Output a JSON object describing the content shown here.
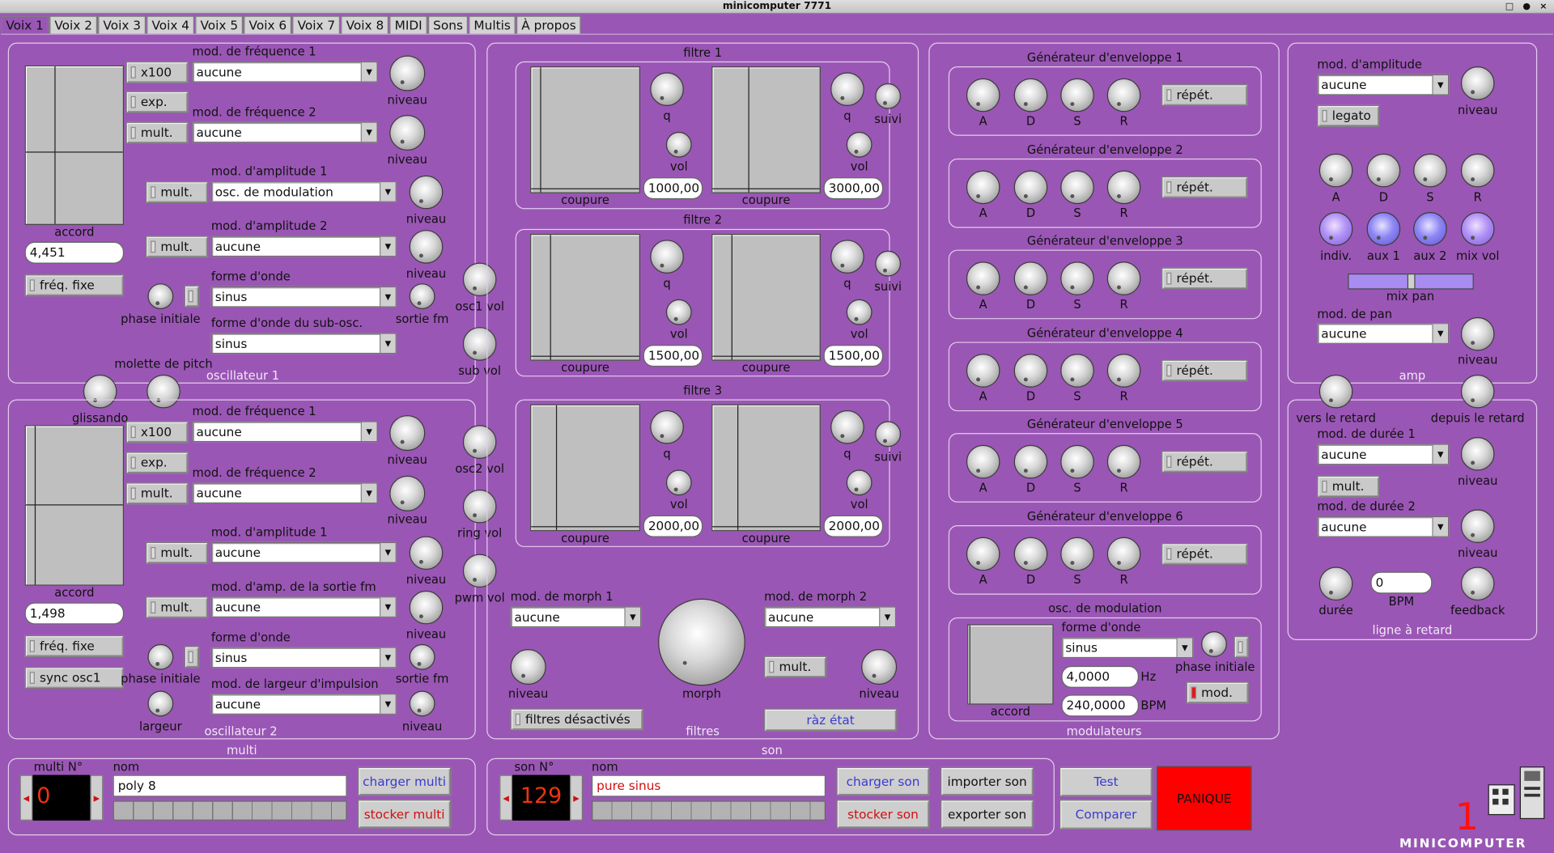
{
  "window": {
    "title": "minicomputer 7771",
    "controls": "□ ● ×"
  },
  "tabs": [
    "Voix 1",
    "Voix 2",
    "Voix 3",
    "Voix 4",
    "Voix 5",
    "Voix 6",
    "Voix 7",
    "Voix 8",
    "MIDI",
    "Sons",
    "Multis",
    "À propos"
  ],
  "osc1": {
    "group": "oscillateur 1",
    "x100": "x100",
    "exp": "exp.",
    "mult": "mult.",
    "mod_freq1": "mod. de fréquence 1",
    "mod_freq1_val": "aucune",
    "mod_freq2": "mod. de fréquence 2",
    "mod_freq2_val": "aucune",
    "niveau": "niveau",
    "mod_amp1": "mod. d'amplitude 1",
    "mod_amp1_val": "osc. de modulation",
    "mod_amp2": "mod. d'amplitude 2",
    "mod_amp2_val": "aucune",
    "accord": "accord",
    "accord_val": "4,451",
    "freq_fixe": "fréq. fixe",
    "phase": "phase initiale",
    "forme": "forme d'onde",
    "forme_val": "sinus",
    "sortie_fm": "sortie fm",
    "sub_forme": "forme d'onde du sub-osc.",
    "sub_forme_val": "sinus",
    "osc1vol": "osc1 vol",
    "subvol": "sub vol",
    "molette": "molette de pitch",
    "glissando": "glissando"
  },
  "osc2": {
    "group": "oscillateur 2",
    "x100": "x100",
    "exp": "exp.",
    "mult": "mult.",
    "mod_freq1": "mod. de fréquence 1",
    "mod_freq1_val": "aucune",
    "mod_freq2": "mod. de fréquence 2",
    "mod_freq2_val": "aucune",
    "niveau": "niveau",
    "mod_amp1": "mod. d'amplitude 1",
    "mod_amp1_val": "aucune",
    "mod_amp_fm": "mod. d'amp. de la sortie fm",
    "mod_amp_fm_val": "aucune",
    "accord": "accord",
    "accord_val": "1,498",
    "freq_fixe": "fréq. fixe",
    "sync": "sync osc1",
    "phase": "phase initiale",
    "forme": "forme d'onde",
    "forme_val": "sinus",
    "sortie_fm": "sortie fm",
    "mod_largeur": "mod. de largeur d'impulsion",
    "mod_largeur_val": "aucune",
    "largeur": "largeur",
    "osc2vol": "osc2 vol",
    "ringvol": "ring vol",
    "pwmvol": "pwm vol"
  },
  "filtres": {
    "group": "filtres",
    "f1": "filtre 1",
    "f2": "filtre 2",
    "f3": "filtre 3",
    "q": "q",
    "vol": "vol",
    "suivi": "suivi",
    "coupure": "coupure",
    "f1a": "1000,00",
    "f1b": "3000,00",
    "f2a": "1500,00",
    "f2b": "1500,00",
    "f3a": "2000,00",
    "f3b": "2000,00",
    "morph1": "mod. de morph 1",
    "morph1_val": "aucune",
    "morph2": "mod. de morph 2",
    "morph2_val": "aucune",
    "niveau": "niveau",
    "morph": "morph",
    "mult": "mult.",
    "filtres_off": "filtres désactivés",
    "raz": "ràz état"
  },
  "mod": {
    "group": "modulateurs",
    "env": [
      "Générateur d'enveloppe 1",
      "Générateur d'enveloppe 2",
      "Générateur d'enveloppe 3",
      "Générateur d'enveloppe 4",
      "Générateur d'enveloppe 5",
      "Générateur d'enveloppe 6"
    ],
    "adsr": [
      "A",
      "D",
      "S",
      "R"
    ],
    "repet": "répét.",
    "osc": "osc. de modulation",
    "forme": "forme d'onde",
    "forme_val": "sinus",
    "hz_val": "4,0000",
    "hz": "Hz",
    "bpm_val": "240,0000",
    "bpm": "BPM",
    "phase": "phase initiale",
    "mod": "mod.",
    "accord": "accord"
  },
  "amp": {
    "group": "amp",
    "mod_amp": "mod. d'amplitude",
    "mod_amp_val": "aucune",
    "niveau": "niveau",
    "legato": "legato",
    "adsr": [
      "A",
      "D",
      "S",
      "R"
    ],
    "indiv": "indiv.",
    "aux1": "aux 1",
    "aux2": "aux 2",
    "mixvol": "mix vol",
    "mixpan": "mix pan",
    "mod_pan": "mod. de pan",
    "mod_pan_val": "aucune"
  },
  "delay": {
    "group": "ligne à retard",
    "vers": "vers le retard",
    "depuis": "depuis le retard",
    "mod_d1": "mod. de durée 1",
    "mod_d1_val": "aucune",
    "niveau": "niveau",
    "mult": "mult.",
    "mod_d2": "mod. de durée 2",
    "mod_d2_val": "aucune",
    "duree": "durée",
    "bpm_val": "0",
    "bpm": "BPM",
    "feedback": "feedback"
  },
  "multi": {
    "group": "multi",
    "num_label": "multi N°",
    "num": "0",
    "nom": "nom",
    "nom_val": "poly 8",
    "charger": "charger multi",
    "stocker": "stocker multi"
  },
  "son": {
    "group": "son",
    "num_label": "son N°",
    "num": "129",
    "nom": "nom",
    "nom_val": "pure sinus",
    "charger": "charger son",
    "stocker": "stocker son",
    "importer": "importer son",
    "exporter": "exporter son"
  },
  "actions": {
    "test": "Test",
    "comparer": "Comparer",
    "panique": "PANIQUE"
  },
  "logo": {
    "number": "1",
    "text": "MINICOMPUTER"
  },
  "colors": {
    "background": "#9a56b5",
    "panic": "#ff0000",
    "blue_text": "#3a3ad0",
    "red_text": "#d01010"
  }
}
